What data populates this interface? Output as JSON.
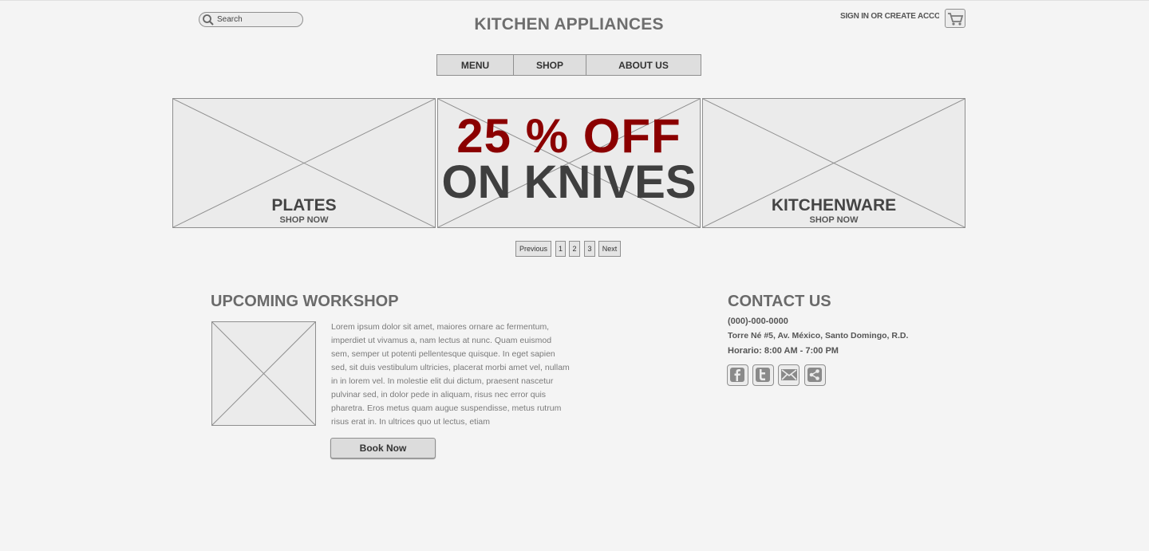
{
  "header": {
    "search_placeholder": "Search",
    "site_title": "KITCHEN APPLIANCES",
    "signin_label": "SIGN IN OR CREATE ACCOUNT"
  },
  "nav": {
    "items": [
      "MENU",
      "SHOP",
      "ABOUT US"
    ]
  },
  "banners": {
    "left": {
      "title": "PLATES",
      "subtitle": "SHOP NOW"
    },
    "center": {
      "line1": "25 % OFF",
      "line2": "ON KNIVES"
    },
    "right": {
      "title": "KITCHENWARE",
      "subtitle": "SHOP NOW"
    }
  },
  "pagination": {
    "previous": "Previous",
    "pages": [
      "1",
      "2",
      "3"
    ],
    "next": "Next"
  },
  "workshop": {
    "heading": "UPCOMING WORKSHOP",
    "body": "Lorem ipsum dolor sit amet, maiores ornare ac fermentum, imperdiet ut vivamus a, nam lectus at nunc. Quam euismod sem, semper ut potenti pellentesque quisque. In eget sapien sed, sit duis vestibulum ultricies, placerat morbi amet vel, nullam in in lorem vel. In molestie elit dui dictum, praesent nascetur pulvinar sed, in dolor pede in aliquam, risus nec error quis pharetra. Eros metus quam augue suspendisse, metus rutrum risus erat in.  In ultrices quo ut lectus, etiam",
    "button": "Book Now"
  },
  "contact": {
    "heading": "CONTACT US",
    "phone": "(000)-000-0000",
    "address": "Torre Né #5, Av. México, Santo Domingo, R.D.",
    "hours": "Horario: 8:00 AM - 7:00 PM",
    "social_icons": [
      "facebook-icon",
      "twitter-icon",
      "email-icon",
      "share-icon"
    ]
  }
}
